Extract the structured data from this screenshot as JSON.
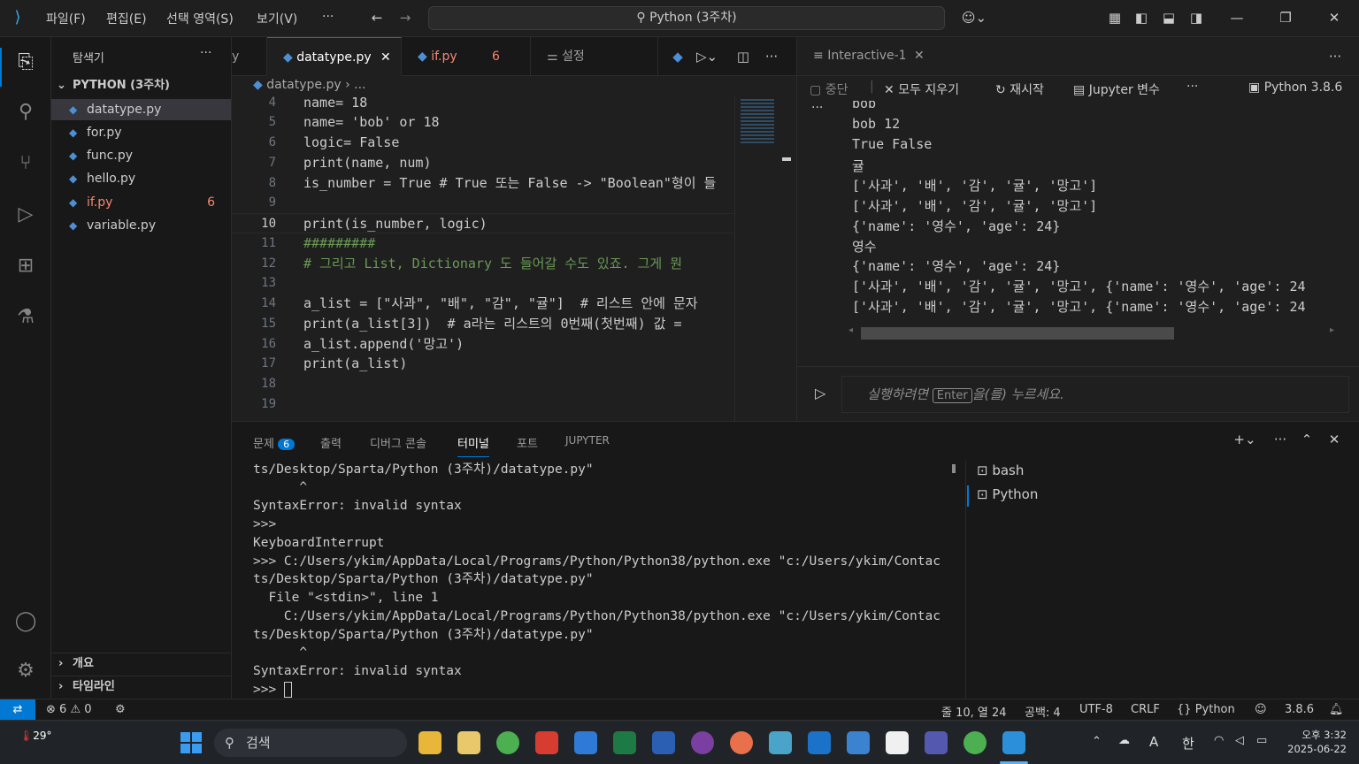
{
  "menu": {
    "file": "파일(F)",
    "edit": "편집(E)",
    "selection": "선택 영역(S)",
    "view": "보기(V)",
    "more": "···"
  },
  "search": {
    "label": "Python (3주차)"
  },
  "explorer": {
    "title": "탐색기",
    "more": "···",
    "folder": "PYTHON (3주차)",
    "files": [
      {
        "name": "datatype.py"
      },
      {
        "name": "for.py"
      },
      {
        "name": "func.py"
      },
      {
        "name": "hello.py"
      },
      {
        "name": "if.py",
        "badge": "6"
      },
      {
        "name": "variable.py"
      }
    ],
    "outline": "개요",
    "timeline": "타임라인"
  },
  "tabs": {
    "partial": "y",
    "datatype": "datatype.py",
    "if": "if.py",
    "if_badge": "6",
    "settings": "설정"
  },
  "breadcrumb": {
    "file": "datatype.py",
    "rest": "..."
  },
  "code_lines": [
    {
      "n": "4",
      "t": "name= 18"
    },
    {
      "n": "5",
      "t": "name= 'bob' or 18"
    },
    {
      "n": "6",
      "t": "logic= False"
    },
    {
      "n": "7",
      "t": "print(name, num)"
    },
    {
      "n": "8",
      "t": "is_number = True # True 또는 False -> \"Boolean\"형이 들"
    },
    {
      "n": "9",
      "t": ""
    },
    {
      "n": "10",
      "t": "print(is_number, logic)"
    },
    {
      "n": "11",
      "t": "#########"
    },
    {
      "n": "12",
      "t": "# 그리고 List, Dictionary 도 들어갈 수도 있죠. 그게 뭔"
    },
    {
      "n": "13",
      "t": ""
    },
    {
      "n": "14",
      "t": "a_list = [\"사과\", \"배\", \"감\", \"귤\"]  # 리스트 안에 문자"
    },
    {
      "n": "15",
      "t": "print(a_list[3])  # a라는 리스트의 0번째(첫번째) 값 ="
    },
    {
      "n": "16",
      "t": "a_list.append('망고')"
    },
    {
      "n": "17",
      "t": "print(a_list)"
    },
    {
      "n": "18",
      "t": ""
    },
    {
      "n": "19",
      "t": ""
    }
  ],
  "interactive": {
    "tab": "Interactive-1",
    "interrupt": "중단",
    "clear_all": "모두 지우기",
    "restart": "재시작",
    "variables": "Jupyter 변수",
    "kernel": "Python 3.8.6",
    "output": [
      "bob",
      "bob 12",
      "True False",
      "귤",
      "['사과', '배', '감', '귤', '망고']",
      "['사과', '배', '감', '귤', '망고']",
      "{'name': '영수', 'age': 24}",
      "영수",
      "{'name': '영수', 'age': 24}",
      "['사과', '배', '감', '귤', '망고', {'name': '영수', 'age': 24",
      "['사과', '배', '감', '귤', '망고', {'name': '영수', 'age': 24"
    ],
    "input_hint_a": "실행하려면",
    "input_key": "Enter",
    "input_hint_b": "을(를) 누르세요."
  },
  "panel": {
    "tabs": {
      "problems": "문제",
      "problems_count": "6",
      "output": "출력",
      "debug": "디버그 콘솔",
      "terminal": "터미널",
      "ports": "포트",
      "jupyter": "JUPYTER"
    },
    "terminal": [
      "ts/Desktop/Sparta/Python (3주차)/datatype.py\"",
      "      ^",
      "SyntaxError: invalid syntax",
      ">>>",
      "KeyboardInterrupt",
      ">>> C:/Users/ykim/AppData/Local/Programs/Python/Python38/python.exe \"c:/Users/ykim/Contac",
      "ts/Desktop/Sparta/Python (3주차)/datatype.py\"",
      "  File \"<stdin>\", line 1",
      "    C:/Users/ykim/AppData/Local/Programs/Python/Python38/python.exe \"c:/Users/ykim/Contac",
      "ts/Desktop/Sparta/Python (3주차)/datatype.py\"",
      "      ^",
      "SyntaxError: invalid syntax",
      ">>> "
    ],
    "shells": [
      "bash",
      "Python"
    ]
  },
  "status": {
    "errors": "6",
    "warnings": "0",
    "position": "줄 10, 열 24",
    "spaces": "공백: 4",
    "encoding": "UTF-8",
    "eol": "CRLF",
    "language": "Python",
    "version": "3.8.6"
  },
  "taskbar": {
    "weather": "29°",
    "search": "검색",
    "ime_a": "A",
    "ime_ko": "한",
    "time": "오후 3:32",
    "date": "2025-06-22"
  }
}
